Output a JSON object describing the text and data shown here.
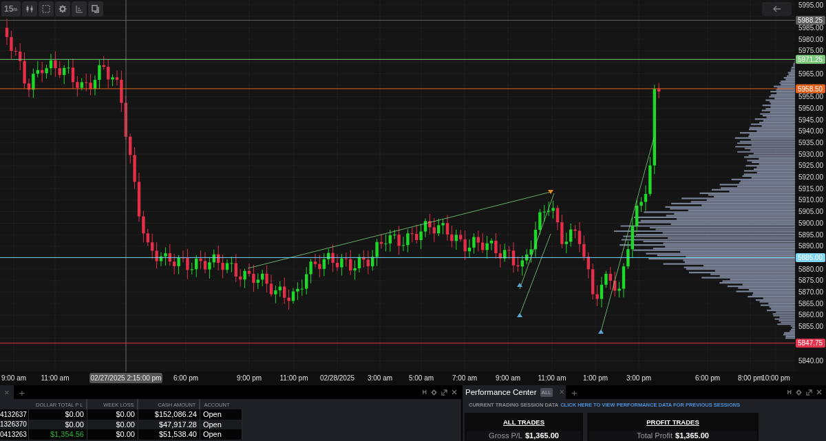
{
  "toolbar": {
    "timeframe": "15$^{m}$"
  },
  "price_axis": {
    "ticks": [
      "5995.00",
      "5985.00",
      "5980.00",
      "5975.00",
      "5965.00",
      "5955.00",
      "5950.00",
      "5945.00",
      "5940.00",
      "5935.00",
      "5930.00",
      "5925.00",
      "5920.00",
      "5915.00",
      "5910.00",
      "5905.00",
      "5900.00",
      "5895.00",
      "5890.00",
      "5880.00",
      "5875.00",
      "5870.00",
      "5865.00",
      "5860.00",
      "5855.00",
      "5840.00"
    ]
  },
  "price_levels": [
    {
      "label": "5988.25",
      "color": "#5c5c5c"
    },
    {
      "label": "5971.25",
      "color": "#7cc97c"
    },
    {
      "label": "5958.50",
      "color": "#e4621c"
    },
    {
      "label": "5885.00",
      "color": "#7ed6f2"
    },
    {
      "label": "5847.75",
      "color": "#e5344e"
    }
  ],
  "time_axis": {
    "labels": [
      "9:00 am",
      "11:00 am",
      "6:00 pm",
      "9:00 pm",
      "11:00 pm",
      "02/28/2025",
      "3:00 am",
      "5:00 am",
      "7:00 am",
      "9:00 am",
      "11:00 am",
      "1:00 pm",
      "3:00 pm",
      "6:00 pm",
      "8:00 pm",
      "10:00 pm"
    ],
    "crosshair_label": "02/27/2025 2:15:00 pm"
  },
  "account_panel": {
    "close_tab": "×",
    "add_tab": "+",
    "hotkey": "H",
    "columns": [
      "DOLLAR TOTAL P L",
      "WEEK LOSS",
      "CASH AMOUNT",
      "ACCOUNT"
    ],
    "rows": [
      {
        "column_1": "4132637",
        "cells": [
          "$0.00",
          "$0.00",
          "$152,086.24",
          "Open"
        ],
        "gain": false
      },
      {
        "column_1": "1326370",
        "cells": [
          "$0.00",
          "$0.00",
          "$47,917.28",
          "Open"
        ],
        "gain": false
      },
      {
        "column_1": "0413263",
        "cells": [
          "$1,354.56",
          "$0.00",
          "$51,538.40",
          "Open"
        ],
        "gain": true
      }
    ]
  },
  "performance_panel": {
    "close_tab": "×",
    "add_tab": "+",
    "hotkey": "H",
    "title": "Performance Center",
    "badge": "ALL",
    "session_label": "CURRENT TRADING SESSION DATA",
    "session_link": "CLICK HERE TO VIEW PERFORMANCE DATA FOR PREVIOUS SESSIONS",
    "cards": [
      {
        "title": "ALL TRADES",
        "label": "Gross P/L",
        "value": "$1,365.00"
      },
      {
        "title": "PROFIT TRADES",
        "label": "Total Profit",
        "value": "$1,365.00"
      }
    ]
  }
}
